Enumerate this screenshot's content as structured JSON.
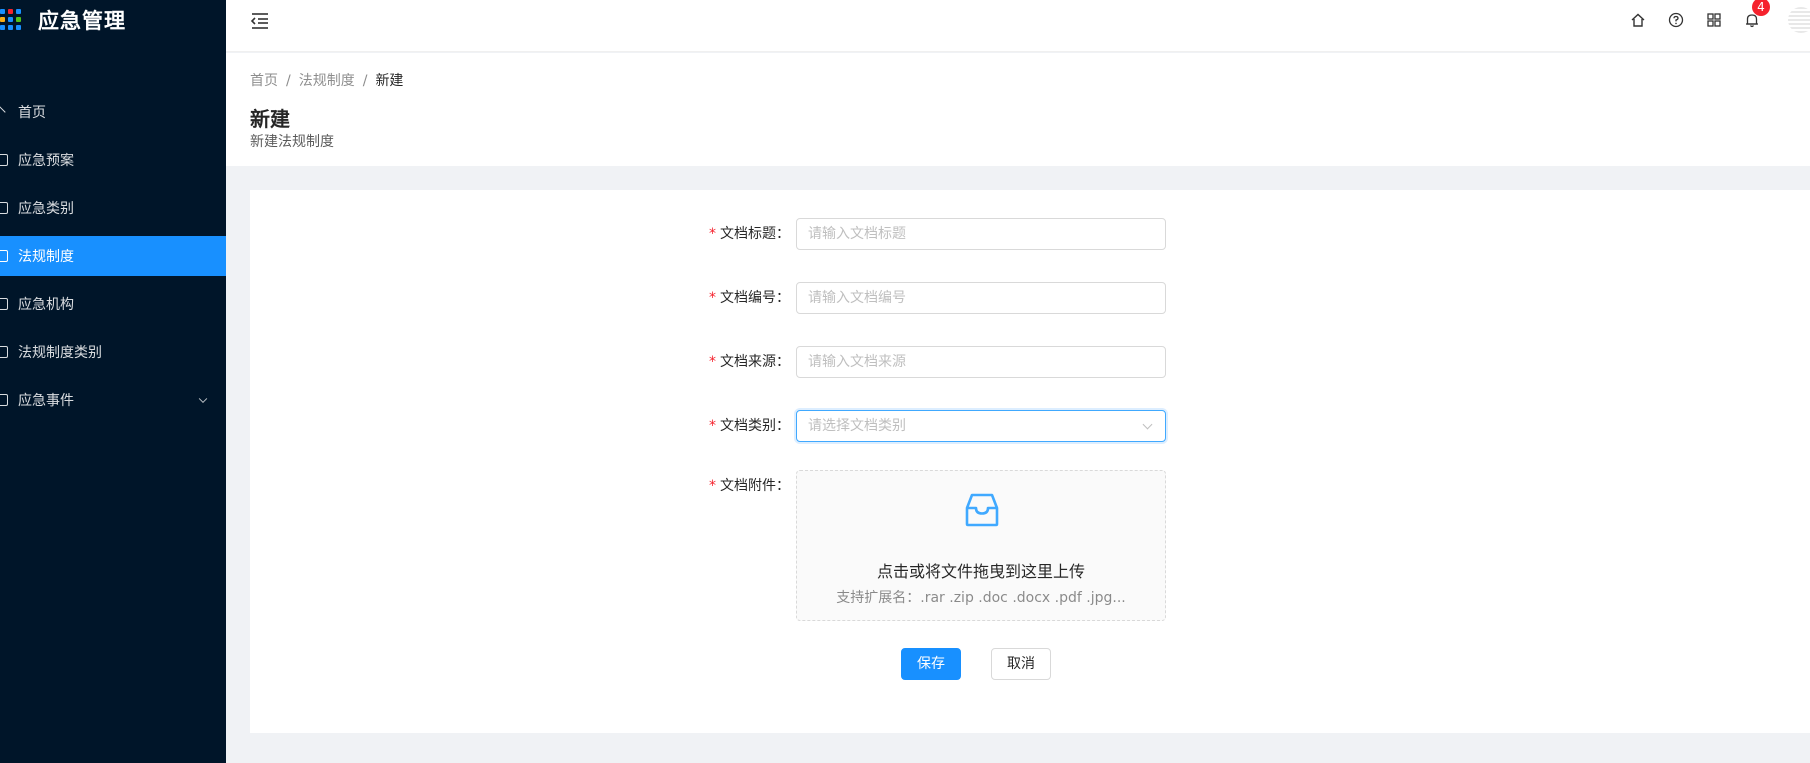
{
  "app": {
    "title": "应急管理",
    "accent_color": "#1890ff",
    "sidebar_bg": "#001529",
    "logo_colors": [
      "#1890ff",
      "#f5222d",
      "#1890ff",
      "#faad14",
      "#1890ff",
      "#52c41a",
      "#1890ff",
      "#1890ff",
      "#1890ff"
    ]
  },
  "sidebar": {
    "items": [
      {
        "label": "首页",
        "icon": "home-icon",
        "active": false
      },
      {
        "label": "应急预案",
        "icon": "file-icon",
        "active": false
      },
      {
        "label": "应急类别",
        "icon": "file-icon",
        "active": false
      },
      {
        "label": "法规制度",
        "icon": "file-icon",
        "active": true
      },
      {
        "label": "应急机构",
        "icon": "file-icon",
        "active": false
      },
      {
        "label": "法规制度类别",
        "icon": "file-icon",
        "active": false
      },
      {
        "label": "应急事件",
        "icon": "file-icon",
        "active": false,
        "has_submenu": true
      }
    ]
  },
  "header": {
    "icons": [
      "home-icon",
      "question-circle-icon",
      "appstore-icon",
      "bell-icon"
    ],
    "notification_count": "4"
  },
  "breadcrumb": {
    "items": [
      "首页",
      "法规制度",
      "新建"
    ],
    "separator": "/"
  },
  "page": {
    "title": "新建",
    "subtitle": "新建法规制度"
  },
  "form": {
    "fields": [
      {
        "label": "文档标题",
        "colon": "：",
        "type": "input",
        "placeholder": "请输入文档标题",
        "value": ""
      },
      {
        "label": "文档编号",
        "colon": "：",
        "type": "input",
        "placeholder": "请输入文档编号",
        "value": ""
      },
      {
        "label": "文档来源",
        "colon": "：",
        "type": "input",
        "placeholder": "请输入文档来源",
        "value": ""
      },
      {
        "label": "文档类别",
        "colon": "：",
        "type": "select",
        "placeholder": "请选择文档类别",
        "value": ""
      },
      {
        "label": "文档附件",
        "colon": "：",
        "type": "upload"
      }
    ],
    "upload": {
      "text": "点击或将文件拖曳到这里上传",
      "hint": "支持扩展名：.rar .zip .doc .docx .pdf .jpg..."
    },
    "save_label": "保存",
    "cancel_label": "取消"
  }
}
